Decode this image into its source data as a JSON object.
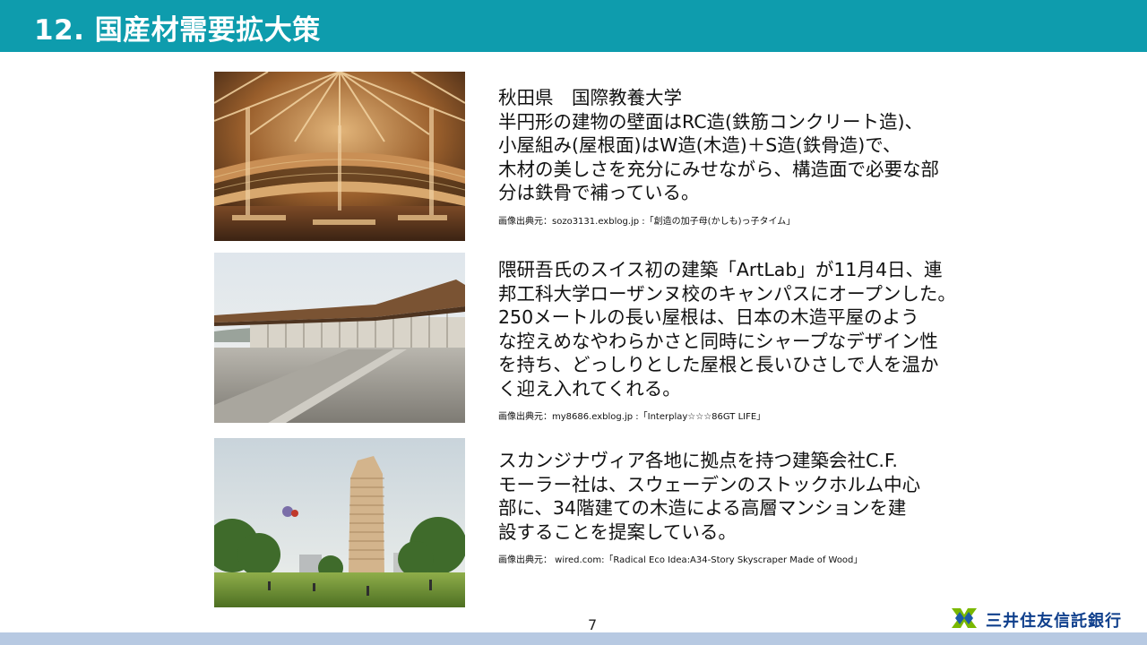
{
  "header": {
    "title": "12. 国産材需要拡大策"
  },
  "slides": [
    {
      "description": "秋田県　国際教養大学\n半円形の建物の壁面はRC造(鉄筋コンクリート造)、\n小屋組み(屋根面)はW造(木造)＋S造(鉄骨造)で、\n木材の美しさを充分にみせながら、構造面で必要な部\n分は鉄骨で補っている。",
      "credit": "画像出典元：sozo3131.exblog.jp :「創造の加子母(かしも)っ子タイム」"
    },
    {
      "description": "隈研吾氏のスイス初の建築「ArtLab」が11月4日、連\n邦工科大学ローザンヌ校のキャンパスにオープンした。\n250メートルの長い屋根は、日本の木造平屋のよう\nな控えめなやわらかさと同時にシャープなデザイン性\nを持ち、どっしりとした屋根と長いひさしで人を温か\nく迎え入れてくれる。",
      "credit": "画像出典元：my8686.exblog.jp :「Interplay☆☆☆86GT LIFE」"
    },
    {
      "description": "スカンジナヴィア各地に拠点を持つ建築会社C.F.\nモーラー社は、スウェーデンのストックホルム中心\n部に、34階建ての木造による高層マンションを建\n設することを提案している。",
      "credit": "画像出典元： wired.com:「Radical Eco Idea:A34-Story Skyscraper Made of Wood」"
    }
  ],
  "footer": {
    "page_number": "7",
    "logo_text": "三井住友信託銀行"
  },
  "colors": {
    "header_bg": "#0e9cad",
    "footer_bar": "#b7c9e2",
    "logo_text": "#0f3f8c",
    "logo_green": "#7ab800",
    "logo_blue": "#1c5aa8"
  },
  "icons": {
    "logo": "mitsui-sumitomo-trust-logo-icon"
  }
}
